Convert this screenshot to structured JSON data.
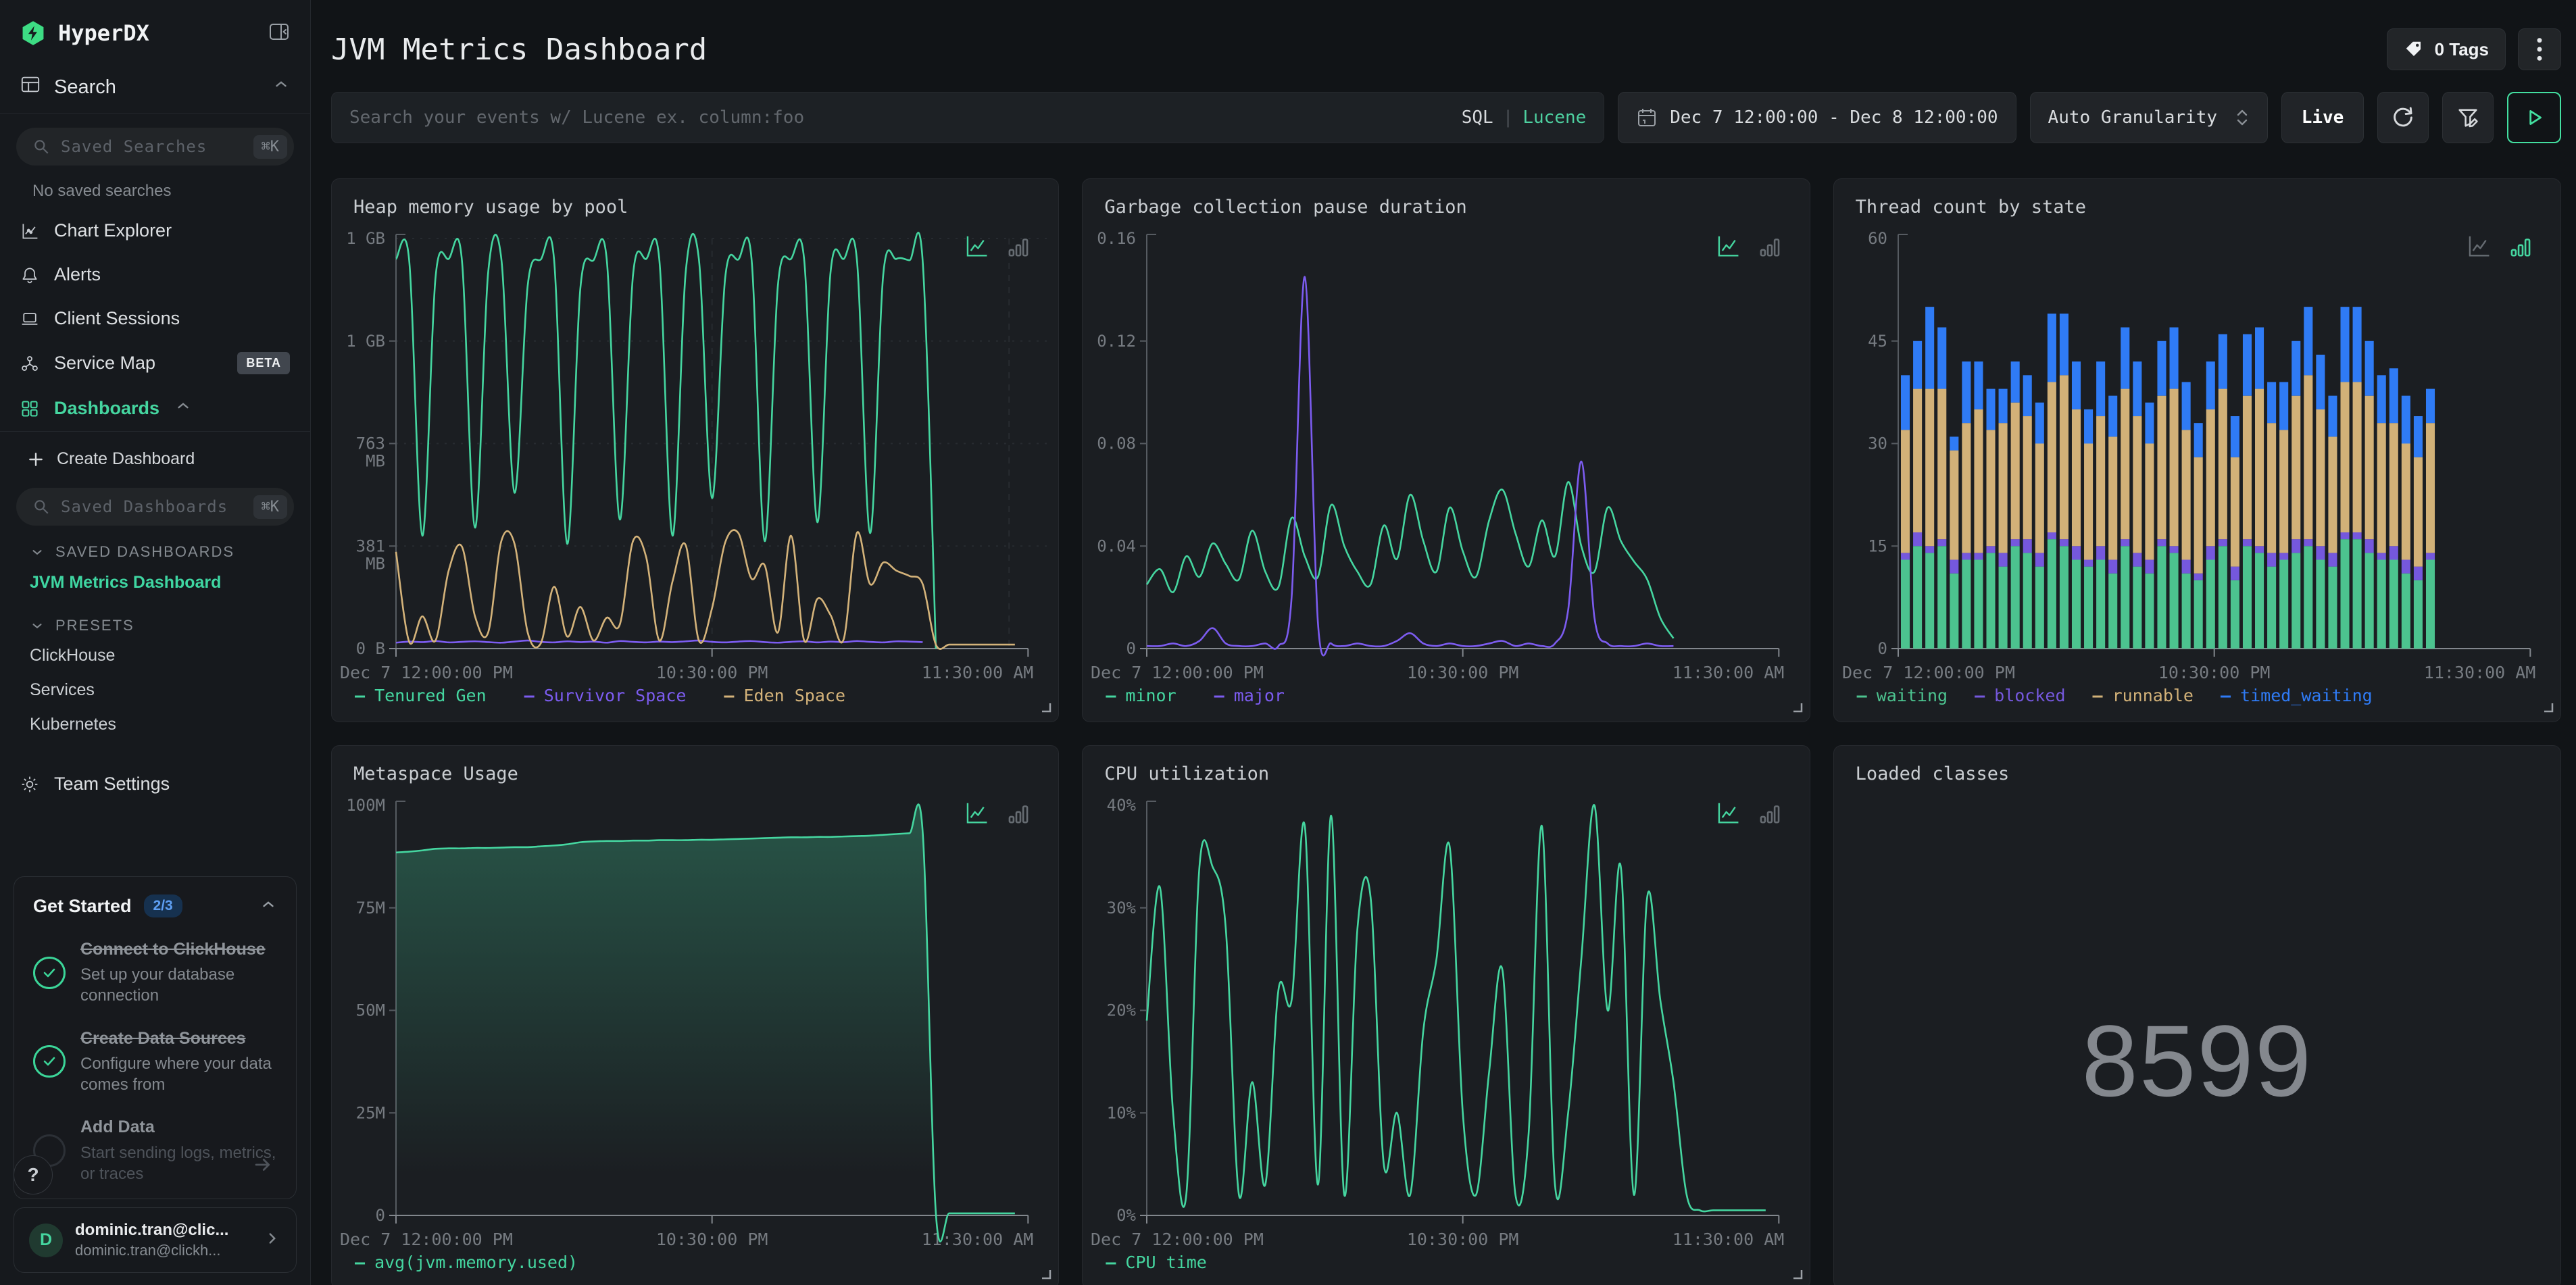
{
  "accent": "#45d6a0",
  "sidebar": {
    "brand": "HyperDX",
    "search_section": "Search",
    "saved_searches_placeholder": "Saved Searches",
    "shortcut": "⌘K",
    "no_saved": "No saved searches",
    "nav": [
      {
        "label": "Chart Explorer"
      },
      {
        "label": "Alerts"
      },
      {
        "label": "Client Sessions"
      },
      {
        "label": "Service Map",
        "badge": "BETA"
      },
      {
        "label": "Dashboards"
      }
    ],
    "create_dashboard": "Create Dashboard",
    "saved_dashboards_placeholder": "Saved Dashboards",
    "saved_dashboards_header": "SAVED DASHBOARDS",
    "active_dashboard": "JVM Metrics Dashboard",
    "presets_header": "PRESETS",
    "presets": [
      "ClickHouse",
      "Services",
      "Kubernetes"
    ],
    "team_settings": "Team Settings",
    "get_started": {
      "title": "Get Started",
      "badge": "2/3",
      "items": [
        {
          "title": "Connect to ClickHouse",
          "desc": "Set up your database connection",
          "done": true
        },
        {
          "title": "Create Data Sources",
          "desc": "Configure where your data comes from",
          "done": true
        },
        {
          "title": "Add Data",
          "desc": "Start sending logs, metrics, or traces",
          "done": false
        }
      ]
    },
    "help": "?",
    "user": {
      "initial": "D",
      "name": "dominic.tran@clic...",
      "email": "dominic.tran@clickh..."
    }
  },
  "topbar": {
    "title": "JVM Metrics Dashboard",
    "tags": "0 Tags"
  },
  "filter_bar": {
    "search_placeholder": "Search your events w/ Lucene ex. column:foo",
    "sql": "SQL",
    "sep": "|",
    "lucene": "Lucene",
    "date_range": "Dec 7 12:00:00 - Dec 8 12:00:00",
    "granularity": "Auto Granularity",
    "live": "Live"
  },
  "chart_data": [
    {
      "type": "line",
      "mode": "line",
      "title": "Heap memory usage by pool",
      "ymax": 1526,
      "grid": true,
      "vlines": [
        0.5,
        0.97
      ],
      "yticks": [
        {
          "label": "1 GB",
          "frac": 1
        },
        {
          "label": "1 GB",
          "frac": 0.75
        },
        {
          "label": "763\nMB",
          "frac": 0.5
        },
        {
          "label": "381\nMB",
          "frac": 0.25
        },
        {
          "label": "0 B",
          "frac": 0
        }
      ],
      "xticks": [
        "Dec 7 12:00:00 PM",
        "10:30:00 PM",
        "11:30:00 AM"
      ],
      "series": [
        {
          "name": "Tenured Gen",
          "color": "#45d6a0",
          "values": [
            1450,
            1445,
            420,
            1380,
            1450,
            1448,
            450,
            1400,
            1450,
            580,
            1350,
            1448,
            1450,
            390,
            1340,
            1445,
            1450,
            480,
            1390,
            1450,
            1446,
            420,
            1400,
            1450,
            560,
            1380,
            1448,
            1450,
            400,
            1350,
            1450,
            1446,
            470,
            1400,
            1450,
            1448,
            430,
            1390,
            1450,
            1445,
            1440,
            0,
            null,
            null,
            null,
            null,
            null,
            null,
            null
          ]
        },
        {
          "name": "Survivor Space",
          "color": "#7c5cf0",
          "values": [
            22,
            26,
            24,
            28,
            23,
            25,
            27,
            24,
            22,
            26,
            30,
            25,
            23,
            27,
            24,
            26,
            22,
            28,
            25,
            23,
            26,
            24,
            27,
            30,
            25,
            23,
            26,
            28,
            24,
            22,
            25,
            27,
            23,
            26,
            24,
            28,
            25,
            23,
            27,
            26,
            24,
            null,
            null,
            null,
            null,
            null,
            null,
            null,
            null
          ]
        },
        {
          "name": "Eden Space",
          "color": "#d4b37a",
          "values": [
            360,
            25,
            120,
            30,
            290,
            380,
            120,
            60,
            400,
            390,
            60,
            20,
            230,
            45,
            155,
            30,
            115,
            90,
            400,
            340,
            30,
            250,
            385,
            30,
            150,
            395,
            430,
            260,
            310,
            60,
            420,
            30,
            185,
            125,
            35,
            430,
            240,
            320,
            290,
            270,
            240,
            15,
            15,
            15,
            15,
            15,
            15,
            15,
            null
          ]
        }
      ]
    },
    {
      "type": "line",
      "mode": "line",
      "title": "Garbage collection pause duration",
      "ymax": 0.16,
      "grid": false,
      "vlines": [],
      "yticks": [
        {
          "label": "0.16",
          "frac": 1
        },
        {
          "label": "0.12",
          "frac": 0.75
        },
        {
          "label": "0.08",
          "frac": 0.5
        },
        {
          "label": "0.04",
          "frac": 0.25
        },
        {
          "label": "0",
          "frac": 0
        }
      ],
      "xticks": [
        "Dec 7 12:00:00 PM",
        "10:30:00 PM",
        "11:30:00 AM"
      ],
      "series": [
        {
          "name": "minor",
          "color": "#45d6a0",
          "values": [
            0.025,
            0.031,
            0.022,
            0.036,
            0.028,
            0.041,
            0.033,
            0.027,
            0.046,
            0.03,
            0.024,
            0.051,
            0.036,
            0.028,
            0.056,
            0.04,
            0.03,
            0.025,
            0.048,
            0.035,
            0.06,
            0.042,
            0.03,
            0.055,
            0.038,
            0.028,
            0.05,
            0.062,
            0.045,
            0.032,
            0.05,
            0.036,
            0.065,
            0.04,
            0.03,
            0.055,
            0.042,
            0.034,
            0.027,
            0.012,
            0.004,
            null,
            null,
            null,
            null,
            null,
            null,
            null,
            null
          ]
        },
        {
          "name": "major",
          "color": "#7c5cf0",
          "values": [
            0.001,
            0.001,
            0.002,
            0.001,
            0.003,
            0.008,
            0.002,
            0.001,
            0.001,
            0.002,
            0.001,
            0.02,
            0.145,
            0.01,
            0.002,
            0.001,
            0.002,
            0.001,
            0.001,
            0.003,
            0.006,
            0.002,
            0.001,
            0.002,
            0.001,
            0.001,
            0.002,
            0.003,
            0.001,
            0.002,
            0.001,
            0.002,
            0.015,
            0.073,
            0.012,
            0.002,
            0.001,
            0.001,
            0.002,
            0.001,
            0.001,
            null,
            null,
            null,
            null,
            null,
            null,
            null,
            null
          ]
        }
      ]
    },
    {
      "type": "bar",
      "mode": "bar",
      "title": "Thread count by state",
      "ymax": 60,
      "grid": false,
      "vlines": [],
      "bar_span": 0.85,
      "yticks": [
        {
          "label": "60",
          "frac": 1
        },
        {
          "label": "45",
          "frac": 0.75
        },
        {
          "label": "30",
          "frac": 0.5
        },
        {
          "label": "15",
          "frac": 0.25
        },
        {
          "label": "0",
          "frac": 0
        }
      ],
      "xticks": [
        "Dec 7 12:00:00 PM",
        "10:30:00 PM",
        "11:30:00 AM"
      ],
      "series": [
        {
          "name": "waiting",
          "color": "#4cc38f",
          "values": [
            13,
            15,
            14,
            15,
            11,
            13,
            13,
            14,
            12,
            15,
            14,
            12,
            16,
            15,
            13,
            12,
            13,
            11,
            15,
            12,
            11,
            15,
            14,
            11,
            10,
            13,
            15,
            10,
            15,
            14,
            12,
            13,
            14,
            15,
            13,
            12,
            16,
            16,
            14,
            13,
            13,
            11,
            10,
            13
          ]
        },
        {
          "name": "blocked",
          "color": "#7558dd",
          "values": [
            1,
            2,
            1,
            1,
            2,
            1,
            1,
            1,
            2,
            1,
            2,
            2,
            1,
            1,
            2,
            1,
            2,
            2,
            1,
            2,
            2,
            1,
            1,
            2,
            1,
            2,
            1,
            2,
            1,
            1,
            2,
            1,
            2,
            1,
            2,
            2,
            1,
            1,
            2,
            1,
            2,
            2,
            2,
            1
          ]
        },
        {
          "name": "runnable",
          "color": "#d2b178",
          "values": [
            18,
            21,
            23,
            22,
            16,
            19,
            21,
            17,
            19,
            20,
            18,
            16,
            22,
            24,
            20,
            17,
            19,
            18,
            22,
            20,
            17,
            21,
            23,
            19,
            17,
            20,
            22,
            16,
            21,
            23,
            19,
            18,
            21,
            24,
            20,
            17,
            22,
            22,
            21,
            19,
            18,
            17,
            16,
            19
          ]
        },
        {
          "name": "timed_waiting",
          "color": "#2f7bf5",
          "values": [
            8,
            7,
            12,
            9,
            2,
            9,
            7,
            6,
            5,
            6,
            6,
            6,
            10,
            9,
            7,
            5,
            8,
            6,
            9,
            8,
            6,
            8,
            9,
            7,
            5,
            7,
            8,
            6,
            9,
            9,
            6,
            7,
            8,
            10,
            8,
            6,
            11,
            11,
            8,
            7,
            8,
            7,
            6,
            5
          ]
        }
      ]
    },
    {
      "type": "area",
      "mode": "line",
      "title": "Metaspace Usage",
      "ymax": 100,
      "grid": false,
      "vlines": [],
      "yticks": [
        {
          "label": "100M",
          "frac": 1
        },
        {
          "label": "75M",
          "frac": 0.75
        },
        {
          "label": "50M",
          "frac": 0.5
        },
        {
          "label": "25M",
          "frac": 0.25
        },
        {
          "label": "0",
          "frac": 0
        }
      ],
      "xticks": [
        "Dec 7 12:00:00 PM",
        "10:30:00 PM",
        "11:30:00 AM"
      ],
      "series": [
        {
          "name": "avg(jvm.memory.used)",
          "color": "#45d6a0",
          "values": [
            88.5,
            88.7,
            89.0,
            89.4,
            89.5,
            89.5,
            89.6,
            89.6,
            89.7,
            89.8,
            89.8,
            90.0,
            90.2,
            90.5,
            91.0,
            91.2,
            91.3,
            91.3,
            91.4,
            91.4,
            91.5,
            91.5,
            91.5,
            91.6,
            91.6,
            91.7,
            91.8,
            91.9,
            92.0,
            92.1,
            92.2,
            92.2,
            92.3,
            92.3,
            92.4,
            92.5,
            92.6,
            92.8,
            93.0,
            93.2,
            93.4,
            0.5,
            0.5,
            0.5,
            0.5,
            0.5,
            0.5,
            0.5,
            null
          ]
        }
      ]
    },
    {
      "type": "line",
      "mode": "line",
      "title": "CPU utilization",
      "ymax": 40,
      "grid": false,
      "vlines": [],
      "yticks": [
        {
          "label": "40%",
          "frac": 1
        },
        {
          "label": "30%",
          "frac": 0.75
        },
        {
          "label": "20%",
          "frac": 0.5
        },
        {
          "label": "10%",
          "frac": 0.25
        },
        {
          "label": "0%",
          "frac": 0
        }
      ],
      "xticks": [
        "Dec 7 12:00:00 PM",
        "10:30:00 PM",
        "11:30:00 AM"
      ],
      "series": [
        {
          "name": "CPU time",
          "color": "#45d6a0",
          "values": [
            19,
            32,
            10,
            2,
            34,
            34,
            28,
            2,
            13,
            3,
            22,
            21,
            38,
            3,
            39,
            2,
            28,
            31,
            5,
            10,
            2,
            18,
            25,
            36,
            10,
            2,
            14,
            24,
            2,
            8,
            38,
            3,
            10,
            25,
            40,
            20,
            34,
            2,
            31,
            21,
            13,
            2,
            0.5,
            0.5,
            0.5,
            0.5,
            0.5,
            0.5,
            null
          ]
        }
      ]
    },
    {
      "type": "number",
      "title": "Loaded classes",
      "value": "8599"
    }
  ]
}
